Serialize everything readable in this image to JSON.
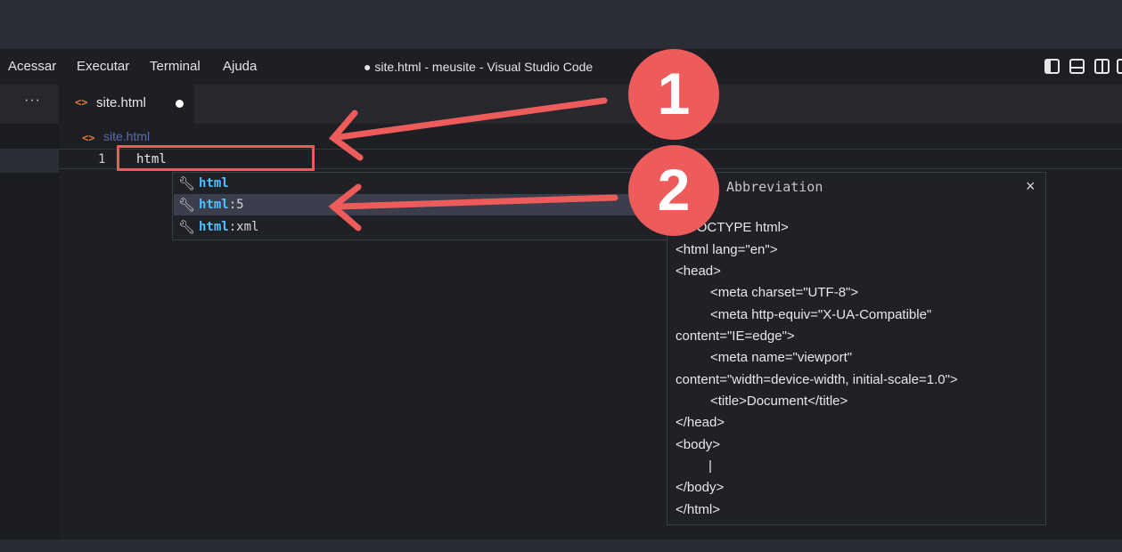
{
  "menu": {
    "items": [
      "Acessar",
      "Executar",
      "Terminal",
      "Ajuda"
    ],
    "window_title": "● site.html - meusite - Visual Studio Code"
  },
  "tabs": {
    "more_label": "···",
    "active": {
      "label": "site.html",
      "icon": "html-file-icon",
      "dirty": true
    }
  },
  "breadcrumb": {
    "label": "site.html",
    "icon": "html-file-icon"
  },
  "editor": {
    "line_number": "1",
    "line_text": "html"
  },
  "suggestions": [
    {
      "match": "html",
      "rest": "",
      "icon": "wrench-icon",
      "selected": false
    },
    {
      "match": "html",
      "rest": ":5",
      "icon": "wrench-icon",
      "selected": true
    },
    {
      "match": "html",
      "rest": ":xml",
      "icon": "wrench-icon",
      "selected": false
    }
  ],
  "details": {
    "title": "Abbreviation",
    "close_label": "×",
    "lines": [
      "<!DOCTYPE html>",
      "<html lang=\"en\">",
      "<head>",
      "<meta charset=\"UTF-8\">",
      "<meta http-equiv=\"X-UA-Compatible\"",
      "content=\"IE=edge\">",
      "<meta name=\"viewport\"",
      "content=\"width=device-width, initial-scale=1.0\">",
      "<title>Document</title>",
      "</head>",
      "<body>",
      "|",
      "</body>",
      "</html>"
    ]
  },
  "annotations": {
    "badge_1": "1",
    "badge_2": "2",
    "color": "#ee5b5b"
  },
  "colors": {
    "accent_highlight": "#4fc1ff",
    "html_icon": "#e37933",
    "annotation": "#ef5a5a"
  }
}
